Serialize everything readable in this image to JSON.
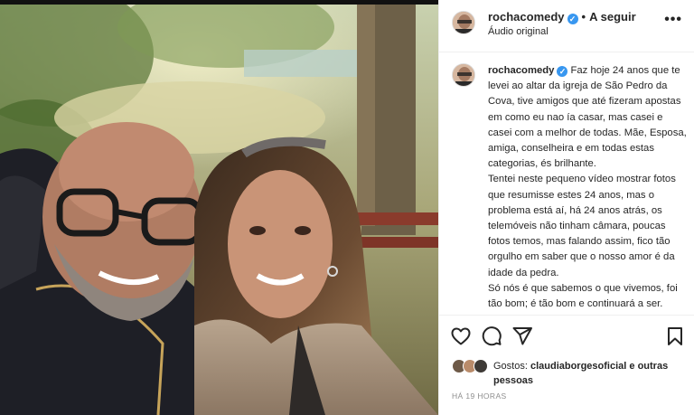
{
  "post": {
    "username": "rochacomedy",
    "verified_mark": "✓",
    "separator": "•",
    "follow_label": "A seguir",
    "audio_label": "Áudio original",
    "more_label": "•••",
    "caption_text": "Faz hoje 24 anos que te levei ao altar da igreja de São Pedro da Cova, tive amigos que até fizeram apostas em como eu nao ía casar, mas casei e casei com a melhor de todas. Mãe, Esposa, amiga, conselheira e em todas estas categorias, és brilhante.\nTentei neste pequeno vídeo mostrar fotos que resumisse estes 24 anos, mas o problema está aí, há 24 anos atrás, os telemóveis não tinham câmara, poucas fotos temos, mas falando assim, fico tão orgulho em saber que o nosso amor é da idade da pedra.\nSó nós é que sabemos o que vivemos, foi tão bom; é tão bom e continuará a ser.",
    "likes_prefix": "Gostos:",
    "likes_user": "claudiaborgesoficial",
    "likes_suffix": "e outras pessoas",
    "time_label": "HÁ 19 HORAS"
  },
  "icons": {
    "like": "heart-icon",
    "comment": "comment-icon",
    "share": "share-icon",
    "save": "bookmark-icon",
    "more": "more-icon"
  },
  "colors": {
    "verified": "#3897f0",
    "text": "#262626",
    "muted": "#8e8e8e",
    "border": "#efefef"
  }
}
